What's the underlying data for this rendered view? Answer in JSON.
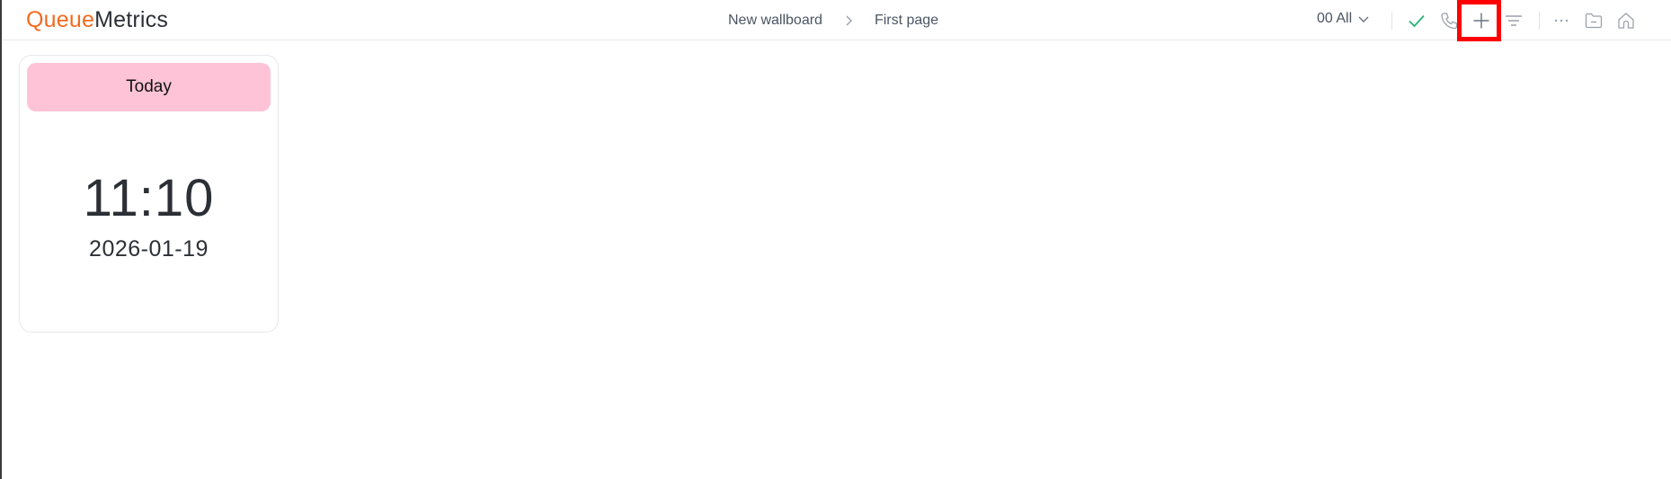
{
  "app": {
    "logo_part1": "Queue",
    "logo_part2": "Metrics",
    "brand_color": "#f26b21"
  },
  "breadcrumb": {
    "items": [
      "New wallboard",
      "First page"
    ]
  },
  "toolbar": {
    "queue_selector": "00 All",
    "icons": [
      "check-icon",
      "phone-icon",
      "plus-icon",
      "filter-icon",
      "more-icon",
      "folder-icon",
      "home-icon"
    ]
  },
  "widget": {
    "header": "Today",
    "header_color": "#fec3d6",
    "time": "11:10",
    "date": "2026-01-19"
  }
}
